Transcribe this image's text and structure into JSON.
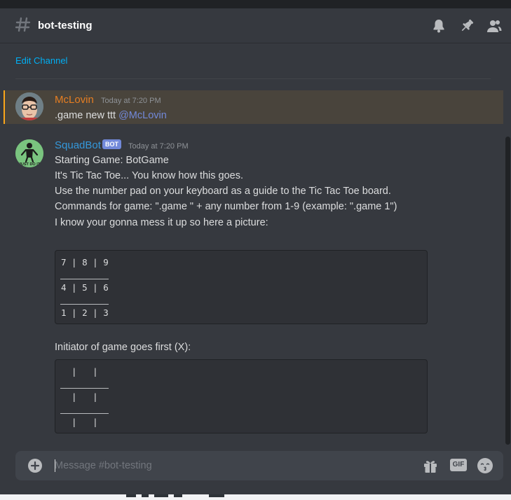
{
  "header": {
    "channel_name": "bot-testing",
    "icons": [
      "hash-icon",
      "bell-icon",
      "pin-icon",
      "members-icon"
    ]
  },
  "channel_intro": {
    "edit_channel_label": "Edit Channel"
  },
  "messages": [
    {
      "author": "McLovin",
      "author_color": "#e67e22",
      "timestamp": "Today at 7:20 PM",
      "content_prefix": ".game new ttt ",
      "mention": "@McLovin",
      "highlighted": true
    },
    {
      "author": "SquadBot",
      "author_color": "#3498db",
      "bot_tag": "BOT",
      "timestamp": "Today at 7:20 PM",
      "avatar_text": "JUST DO IT",
      "lines": [
        "Starting Game: BotGame",
        "It's Tic Tac Toe... You know how this goes.",
        "Use the number pad on your keyboard as a guide to the Tic Tac Toe board.",
        "Commands for game: \".game \" + any number from 1-9 (example: \".game 1\")",
        "I know your gonna mess it up so here a picture:"
      ],
      "guide_board": [
        "7 | 8 | 9",
        "4 | 5 | 6",
        "1 | 2 | 3"
      ],
      "after_text": "Initiator of game goes first (X):",
      "empty_board": [
        "  |   |",
        "  |   |",
        "  |   |"
      ]
    }
  ],
  "composer": {
    "placeholder": "Message #bot-testing",
    "gif_label": "GIF",
    "icons": [
      "add-icon",
      "gift-icon",
      "gif-icon",
      "emoji-icon"
    ]
  },
  "colors": {
    "background": "#36393f",
    "accent_link": "#00aff4",
    "mention": "#7289da",
    "highlight_bar": "#faa61a"
  }
}
